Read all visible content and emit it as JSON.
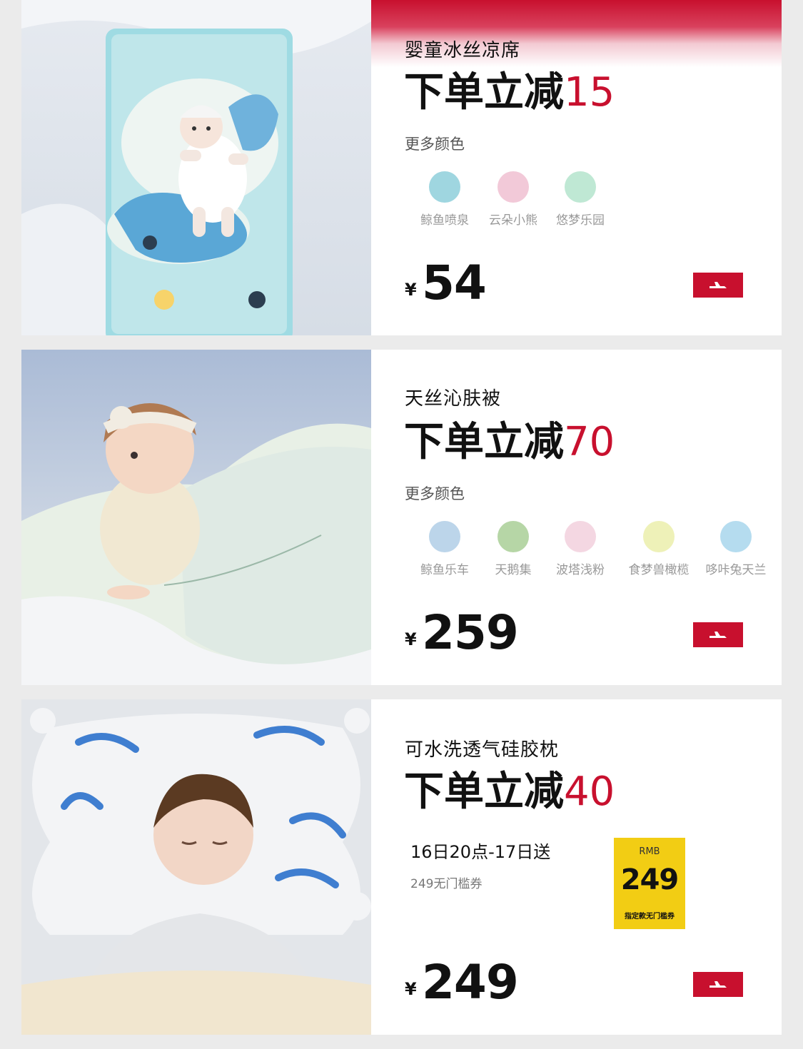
{
  "products": [
    {
      "name": "婴童冰丝凉席",
      "deal_prefix": "下单立减",
      "deal_amount": "15",
      "more_colors_label": "更多颜色",
      "swatches": [
        {
          "label": "鲸鱼喷泉",
          "color": "#9fd6e0"
        },
        {
          "label": "云朵小熊",
          "color": "#f2c9d8"
        },
        {
          "label": "悠梦乐园",
          "color": "#bfe8d4"
        }
      ],
      "currency": "¥",
      "price": "54"
    },
    {
      "name": "天丝沁肤被",
      "deal_prefix": "下单立减",
      "deal_amount": "70",
      "more_colors_label": "更多颜色",
      "swatches": [
        {
          "label": "鲸鱼乐车",
          "color": "#bcd5ea"
        },
        {
          "label": "天鹅集",
          "color": "#b6d6a6"
        },
        {
          "label": "波塔浅粉",
          "color": "#f4d7e2"
        },
        {
          "label": "食梦兽橄榄",
          "color": "#eef1b8"
        },
        {
          "label": "哆咔兔天兰",
          "color": "#b5dcef"
        }
      ],
      "currency": "¥",
      "price": "259"
    },
    {
      "name": "可水洗透气硅胶枕",
      "deal_prefix": "下单立减",
      "deal_amount": "40",
      "promo_date": "16日20点-17日送",
      "promo_sub": "249无门槛券",
      "coupon": {
        "currency": "RMB",
        "amount": "249",
        "note": "指定款无门槛券"
      },
      "currency": "¥",
      "price": "249"
    }
  ],
  "colors": {
    "accent": "#c8102e",
    "coupon_bg": "#f2cd14"
  }
}
